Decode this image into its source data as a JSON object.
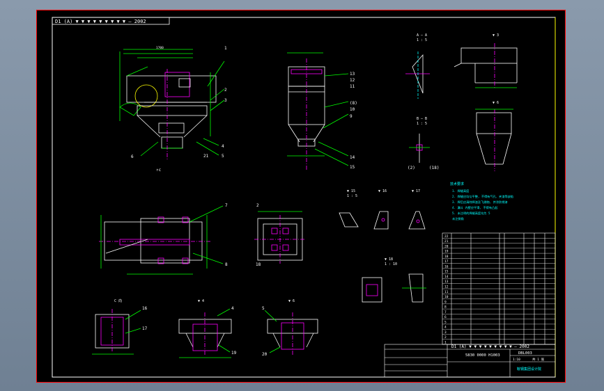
{
  "drawing": {
    "header_title": "D1 (A) ▼ ▼ ▼ ▼ ▼ ▼ ▼ ▼ ▼   – 2002",
    "views": {
      "aa": "A – A",
      "aa_scale": "1 : 5",
      "bb": "B – B",
      "bb_scale": "1 : 5",
      "v3": "▼ 3",
      "v6": "▼ 6",
      "v4": "▼ 4",
      "c_view": "C 向",
      "v15": "▼ 15",
      "v15_scale": "1 : 5",
      "v16": "▼ 16",
      "v17": "▼ 17",
      "v18": "▼ 18",
      "v18_scale": "1 : 10",
      "bottom_c": "↑c"
    },
    "part_numbers": [
      "1",
      "2",
      "3",
      "4",
      "5",
      "6",
      "7",
      "8",
      "9",
      "10",
      "11",
      "12",
      "13",
      "14",
      "15",
      "16",
      "17",
      "18",
      "19",
      "20",
      "21"
    ],
    "detail_marks": [
      "(2)",
      "(18)",
      "(8)"
    ],
    "dims": [
      "1700",
      "900",
      "560",
      "1400",
      "1200",
      "860",
      "1160",
      "1400",
      "700",
      "1020",
      "580",
      "300",
      "100",
      "150",
      "3000"
    ],
    "notes_title": "技术要求",
    "notes": [
      "1. 焊缝高度",
      "2. 焊缝应均匀平整, 不得有气孔、夹渣等缺陷",
      "3. 焊后应清除焊渣及飞溅物, 并涂防锈漆",
      "4. 漏斗 内壁应平滑, 不得有凸起",
      "5. 未注明的焊缝高度均为 5",
      "  未注倒角"
    ]
  },
  "title_block": {
    "title": "D1 (A) ▼ ▼ ▼ ▼ ▼ ▼ ▼ ▼ ▼   – 2002",
    "drawing_no": "5830 0000 H1003",
    "drawing_code": "DBL003",
    "scale_label": "1:10",
    "sheet_label": "共 1 张",
    "company": "鞍钢集团设计院"
  },
  "bom_rows": [
    "22",
    "21",
    "20",
    "19",
    "18",
    "17",
    "16",
    "15",
    "14",
    "13",
    "12",
    "11",
    "10",
    "9",
    "8",
    "7",
    "6",
    "5",
    "4",
    "3",
    "2",
    "1"
  ],
  "colors": {
    "frame": "#ff0000",
    "border": "#ffffff",
    "line_white": "#ffffff",
    "line_green": "#00ff00",
    "line_magenta": "#ff00ff",
    "line_cyan": "#00ffff",
    "line_yellow": "#ffff00"
  }
}
